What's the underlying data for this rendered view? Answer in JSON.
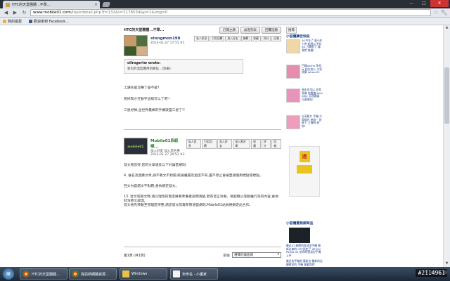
{
  "browser": {
    "tab_title": "HTC的天堂團體 ..不準...",
    "tab_close": "×",
    "url_host": "www.mobile01.com",
    "url_path": "/topicdetail.php?f=132&t=3178534&p=1&img=0",
    "window_min": "—",
    "window_max": "□",
    "window_close": "✕"
  },
  "bookmarks": [
    {
      "label": "我的最愛"
    },
    {
      "label": "歡迎來到 Facebook..."
    }
  ],
  "forum": {
    "title": "HTC的天堂團體 ..不準...",
    "top_buttons": [
      "訂閱主題",
      "加進列表",
      "回覆話題"
    ],
    "post1": {
      "user": "stongmon198",
      "date": "2013-01-27 17:55 #1",
      "actions": [
        "私人訊息",
        "引用回覆",
        "加入好友",
        "編輯",
        "收藏",
        "評分",
        "回報"
      ],
      "quote_author": "oilrogertw wrote:",
      "quote_body": "新也的溫度應用到那些...(恕刪)",
      "lines": [
        "工讀生是沒種了是不是?",
        "管妳我才打動手這樣可以了吧~",
        "三星好棒,全世界最棒的手機就是三星了!!"
      ]
    },
    "post2": {
      "user": "Mobile01系統喇...",
      "subline": "加入好友  加入黑名單",
      "date": "2013-01-27 20:52 #2",
      "actions": [
        "私人訊息",
        "引用回覆",
        "加入好友",
        "加入黑名單",
        "收藏",
        "評分",
        "回報"
      ],
      "logo_text": "mobile01",
      "lines": [
        "發文者您好,您的文章違反以下討論區規則:",
        "4. 會名及回應文章,請不要文不對題,較會離題及過度不同,還不停止會被直接使用標點等標點。",
        "回文內容錯文不對題,會依規定發文。",
        "13. 發文或回文時,請以理性的態度將要準備者說明清楚,若有發言攻擊、挑起戰火等脫離行為的內容,會視狀況移文處理。",
        "該文會先移動至管理區待整,請您發文前再參照適當規則,Mobile01站員將鎖定此合作。"
      ]
    },
    "pager_left": "第1頁 (共1頁)",
    "jump_label": "前往",
    "jump_select": "選擇討論區域"
  },
  "sidebar": {
    "tab_label": "搜尋",
    "title1": "小惡魔廣告快訊",
    "ads": [
      "3G今年了 兩小在人們 超過公子與 4G 刀鋒到了 讓我們 來翻!",
      "鬥陣online 免費玩 找位加入 大家快樂 iphone5!",
      "長年也可以 非常專業 你應當Hello Kitty 至理建議 可要現在!",
      "分享影片 手機 大家都也 參與~ 首頁了 上傳時 給你!"
    ],
    "banner_text": "退",
    "title2": "小惡魔最熱銷商品",
    "phone_text": "最近01 新聞的智慧型手機 最新出來的 HTC設定了 IPHON Papilo G1 給你的智慧型手機上市",
    "bottom_text": "最近的手機相 應新也 最新的比 觀察室的 手機 跟著我們"
  },
  "taskbar": {
    "start_glyph": "⊞",
    "items": [
      {
        "label": "HTC的天堂團體..."
      },
      {
        "label": "資訊熱網路資源..."
      },
      {
        "label": "Windows"
      },
      {
        "label": "未命名 - 小畫家"
      }
    ],
    "tray_lang": "CH"
  },
  "watermark": "#2114961"
}
